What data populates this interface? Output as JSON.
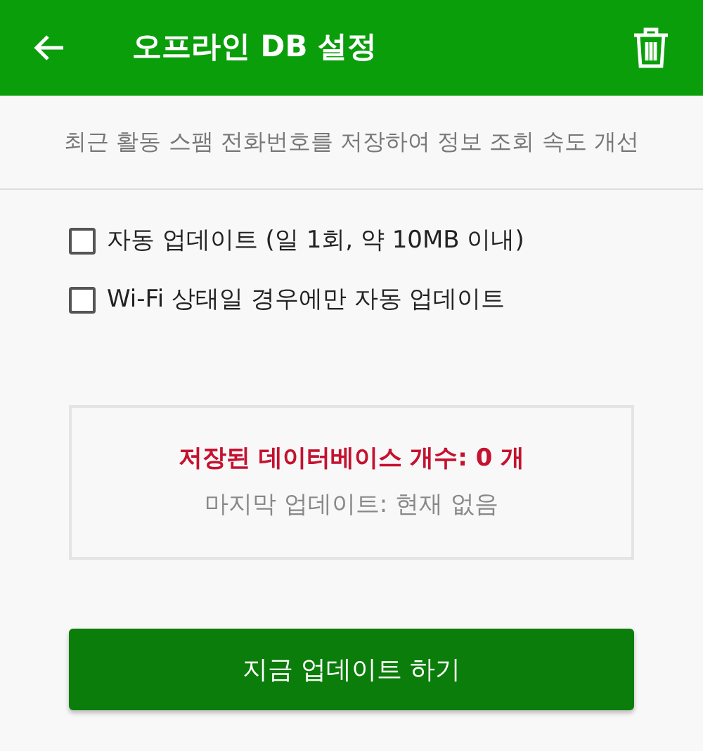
{
  "app_bar": {
    "title": "오프라인 DB 설정"
  },
  "description": "최근 활동 스팸 전화번호를 저장하여 정보 조회 속도 개선",
  "options": [
    {
      "label": "자동 업데이트 (일 1회, 약 10MB 이내)",
      "checked": false
    },
    {
      "label": "Wi-Fi 상태일 경우에만 자동 업데이트",
      "checked": false
    }
  ],
  "status": {
    "count_text": "저장된 데이터베이스 개수: 0 개",
    "last_update": "마지막 업데이트: 현재 없음"
  },
  "update_button": "지금 업데이트 하기"
}
